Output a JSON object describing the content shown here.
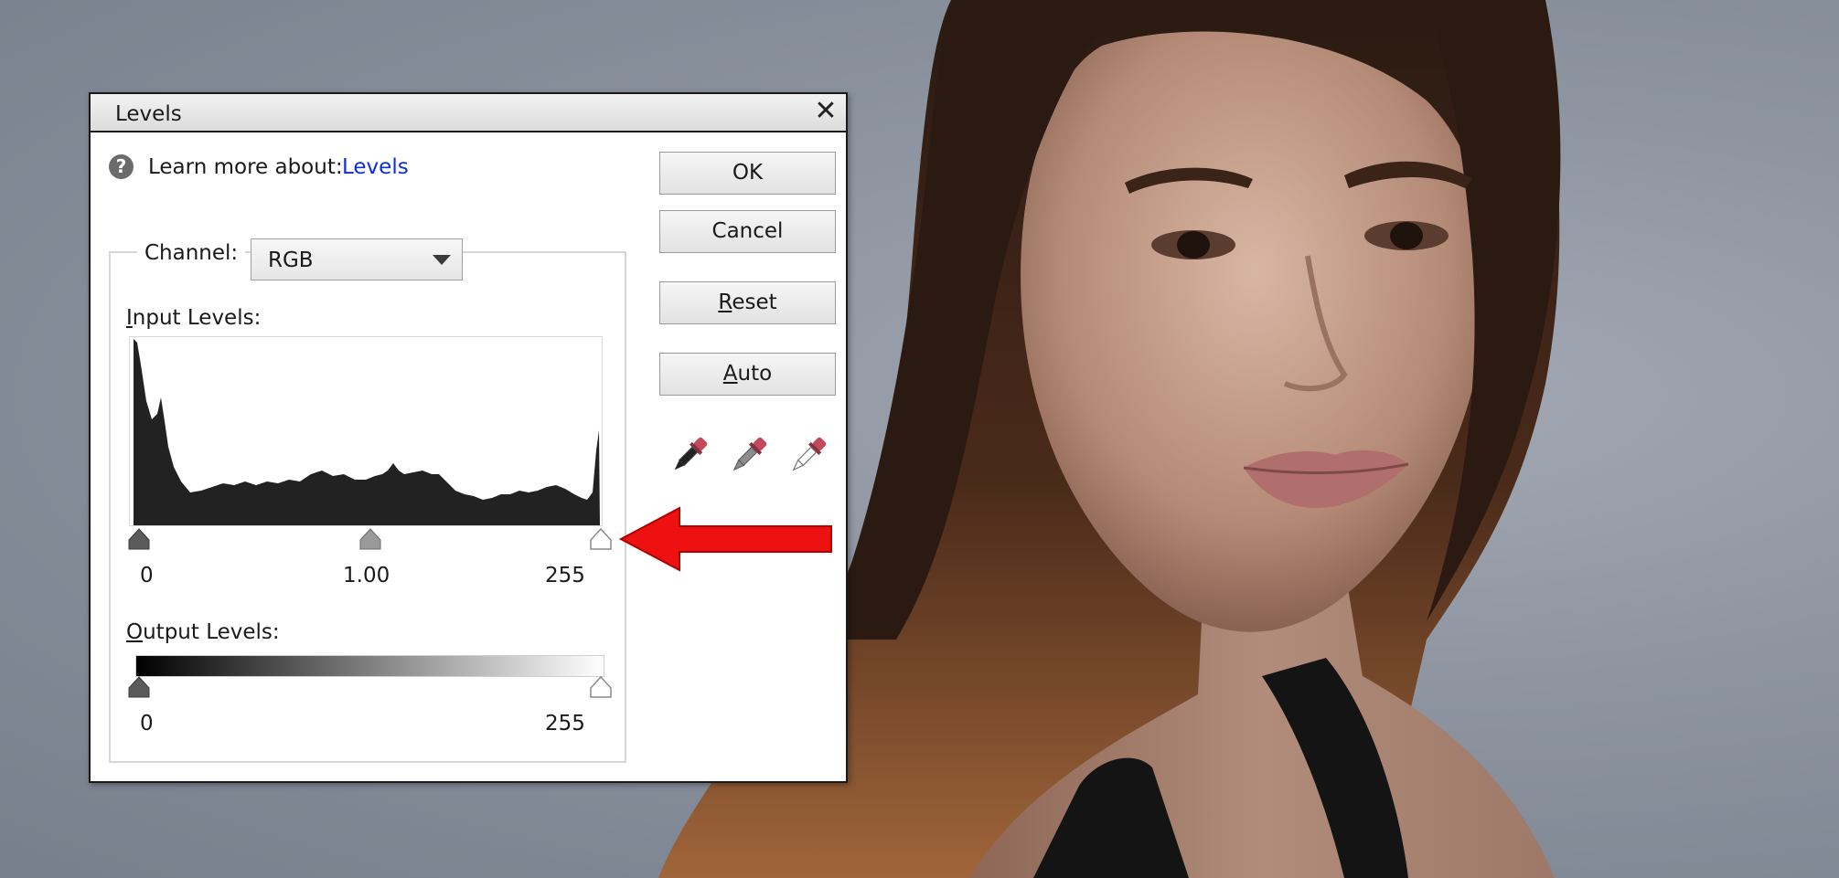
{
  "dialog": {
    "title": "Levels",
    "close_icon": "close-icon",
    "learn_more_label": "Learn more about:",
    "learn_more_link": "Levels",
    "help_icon": "question-icon"
  },
  "channel": {
    "label": "Channel:",
    "selected": "RGB"
  },
  "input_levels": {
    "label": "Input Levels:",
    "black_value": "0",
    "gamma_value": "1.00",
    "white_value": "255"
  },
  "output_levels": {
    "label": "Output Levels:",
    "black_value": "0",
    "white_value": "255"
  },
  "buttons": {
    "ok": "OK",
    "cancel": "Cancel",
    "reset": "Reset",
    "auto": "Auto"
  },
  "eyedroppers": [
    "black-eyedropper-icon",
    "gray-eyedropper-icon",
    "white-eyedropper-icon"
  ],
  "colors": {
    "link": "#0b2fd6",
    "annotation_arrow": "#ee1111",
    "histogram_fill": "#222222"
  }
}
